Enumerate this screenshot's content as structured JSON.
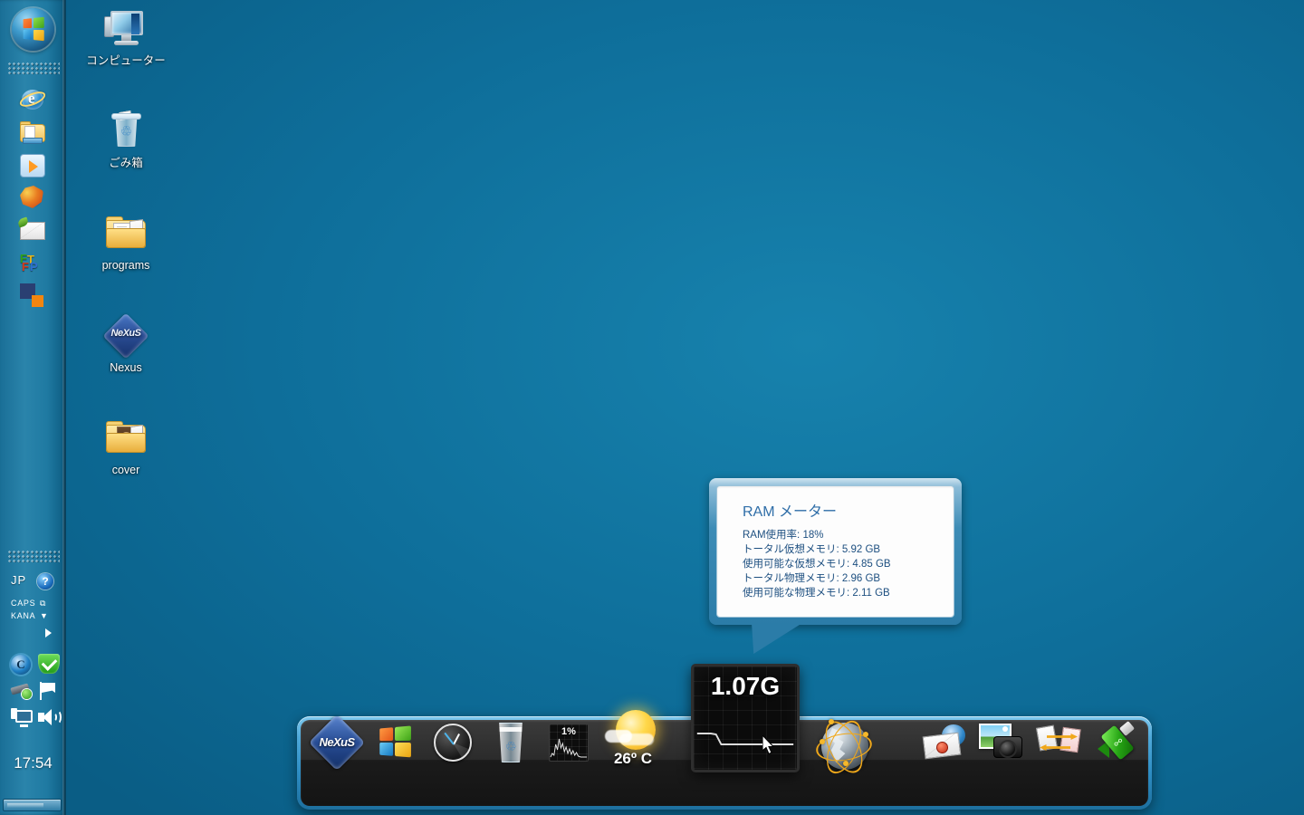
{
  "desktop": {
    "background_color": "#0f6f9b",
    "icons": [
      {
        "label": "コンピューター",
        "icon": "computer-icon"
      },
      {
        "label": "ごみ箱",
        "icon": "recycle-bin-icon"
      },
      {
        "label": "programs",
        "icon": "folder-icon"
      },
      {
        "label": "Nexus",
        "icon": "nexus-icon"
      },
      {
        "label": "cover",
        "icon": "folder-image-icon"
      }
    ]
  },
  "taskbar": {
    "start_button_label": "Start",
    "quick_launch": [
      {
        "name": "internet-explorer-icon",
        "letter": "e"
      },
      {
        "name": "windows-explorer-icon"
      },
      {
        "name": "windows-media-player-icon"
      },
      {
        "name": "firefox-icon"
      },
      {
        "name": "mail-icon"
      },
      {
        "name": "ftp-icon",
        "letters": [
          "F",
          "T",
          "F",
          "P"
        ]
      },
      {
        "name": "squares-icon"
      }
    ],
    "ime": {
      "language": "JP",
      "help": "?",
      "caps_label": "CAPS",
      "kana_label": "KANA"
    },
    "tray_icons": [
      "antivirus-icon",
      "security-shield-icon",
      "safely-remove-hardware-icon",
      "action-center-flag-icon",
      "network-icon",
      "volume-icon"
    ],
    "clock": "17:54"
  },
  "tooltip": {
    "title": "RAM メーター",
    "lines": [
      "RAM使用率: 18%",
      "トータル仮想メモリ: 5.92 GB",
      "使用可能な仮想メモリ: 4.85 GB",
      "トータル物理メモリ: 2.96 GB",
      "使用可能な物理メモリ: 2.11 GB"
    ]
  },
  "ram_widget": {
    "value": "1.07G",
    "name": "ram-meter-widget"
  },
  "dock": {
    "items": [
      {
        "name": "nexus-dock-icon",
        "label": "NeXuS"
      },
      {
        "name": "windows-start-dock-icon"
      },
      {
        "name": "clock-dock-icon"
      },
      {
        "name": "recycle-bin-dock-icon"
      },
      {
        "name": "cpu-meter-dock-icon",
        "value": "1%"
      },
      {
        "name": "weather-dock-icon",
        "value": "26º C"
      },
      {
        "name": "ram-meter-dock-icon",
        "value": "1.07G"
      },
      {
        "name": "network-globe-dock-icon"
      },
      {
        "name": "mail-dock-icon"
      },
      {
        "name": "photos-camera-dock-icon"
      },
      {
        "name": "file-transfer-dock-icon"
      },
      {
        "name": "usb-drive-dock-icon"
      }
    ]
  }
}
